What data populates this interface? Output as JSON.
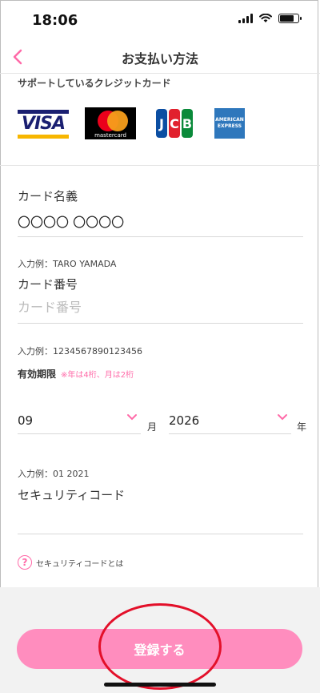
{
  "status_bar": {
    "time": "18:06"
  },
  "nav": {
    "back_icon": "chevron-left-icon",
    "title": "お支払い方法"
  },
  "supported_cards": {
    "heading": "サポートしているクレジットカード",
    "logos": [
      {
        "name": "visa",
        "text": "VISA"
      },
      {
        "name": "mastercard",
        "text": "mastercard"
      },
      {
        "name": "jcb",
        "text": "JCB"
      },
      {
        "name": "amex",
        "text": "AMERICAN EXPRESS"
      }
    ]
  },
  "form": {
    "cardholder": {
      "label": "カード名義",
      "value": "〇〇〇〇 〇〇〇〇",
      "hint": "入力例：TARO YAMADA"
    },
    "card_number": {
      "label": "カード番号",
      "placeholder": "カード番号",
      "hint": "入力例：1234567890123456"
    },
    "expiry": {
      "label": "有効期限",
      "note": "※年は4桁、月は2桁",
      "month": "09",
      "month_unit": "月",
      "year": "2026",
      "year_unit": "年",
      "hint": "入力例：01 2021"
    },
    "security_code": {
      "label": "セキュリティコード",
      "help_text": "セキュリティコードとは",
      "help_icon": "question-circle-icon"
    }
  },
  "submit": {
    "label": "登録する"
  },
  "colors": {
    "accent_pink": "#ff8dbe",
    "annotation_red": "#e3102a"
  }
}
